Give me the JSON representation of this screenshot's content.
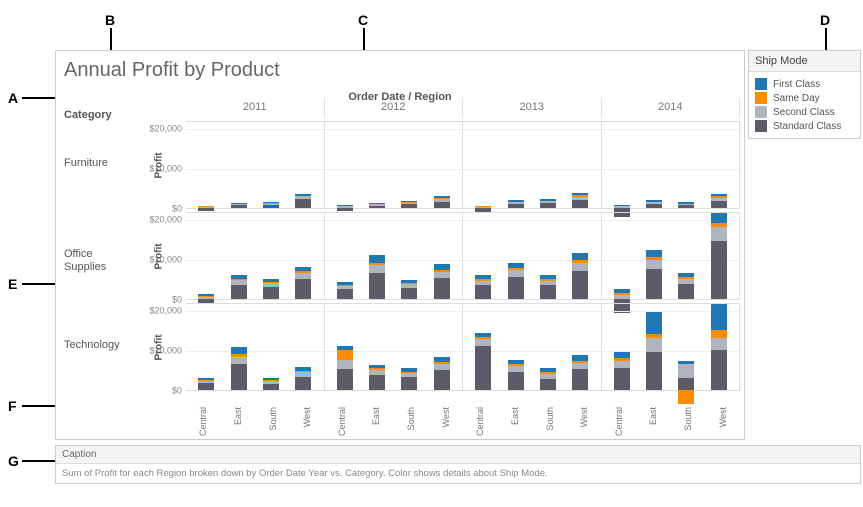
{
  "title": "Annual Profit by Product",
  "super_header": "Order Date / Region",
  "category_header": "Category",
  "legend": {
    "title": "Ship Mode"
  },
  "caption": {
    "label": "Caption",
    "text": "Sum of Profit for each Region broken down by Order Date Year vs. Category.  Color shows details about Ship Mode."
  },
  "callouts": {
    "A": "A",
    "B": "B",
    "C": "C",
    "D": "D",
    "E": "E",
    "F": "F",
    "G": "G"
  },
  "chart_data": {
    "type": "bar",
    "layout": "small-multiples",
    "row_facet": "Category",
    "col_facet": "Order Date (Year)",
    "x_field": "Region",
    "y_field": "Profit",
    "color_field": "Ship Mode",
    "categories_row": [
      "Furniture",
      "Office Supplies",
      "Technology"
    ],
    "categories_col": [
      "2011",
      "2012",
      "2013",
      "2014"
    ],
    "x_categories": [
      "Central",
      "East",
      "South",
      "West"
    ],
    "colors": {
      "First Class": "#1f77b4",
      "Same Day": "#ff8c00",
      "Second Class": "#b0b4bd",
      "Standard Class": "#5c5c66"
    },
    "y_axis": {
      "label": "Profit",
      "ticks": [
        0,
        10000,
        20000
      ],
      "tick_labels": [
        "$0",
        "$10,000",
        "$20,000"
      ],
      "range": [
        -5000,
        22000
      ]
    },
    "series_order": [
      "Standard Class",
      "Second Class",
      "Same Day",
      "First Class"
    ],
    "data": {
      "Furniture": {
        "2011": {
          "Central": {
            "Standard Class": -800,
            "Second Class": 300,
            "Same Day": 100,
            "First Class": 200
          },
          "East": {
            "Standard Class": 700,
            "Second Class": 300,
            "Same Day": 100,
            "First Class": 200
          },
          "South": {
            "Standard Class": 800,
            "Second Class": 300,
            "Same Day": 100,
            "First Class": 300
          },
          "West": {
            "Standard Class": 2300,
            "Second Class": 600,
            "Same Day": 200,
            "First Class": 400
          }
        },
        "2012": {
          "Central": {
            "Standard Class": -700,
            "Second Class": 400,
            "Same Day": 100,
            "First Class": 300
          },
          "East": {
            "Standard Class": 600,
            "Second Class": 300,
            "Same Day": 100,
            "First Class": 300
          },
          "South": {
            "Standard Class": 900,
            "Second Class": 400,
            "Same Day": 100,
            "First Class": 300
          },
          "West": {
            "Standard Class": 1600,
            "Second Class": 600,
            "Same Day": 200,
            "First Class": 500
          }
        },
        "2013": {
          "Central": {
            "Standard Class": -1000,
            "Second Class": 300,
            "Same Day": 100,
            "First Class": 200
          },
          "East": {
            "Standard Class": 1000,
            "Second Class": 400,
            "Same Day": 100,
            "First Class": 400
          },
          "South": {
            "Standard Class": 1200,
            "Second Class": 500,
            "Same Day": 100,
            "First Class": 400
          },
          "West": {
            "Standard Class": 2100,
            "Second Class": 700,
            "Same Day": 400,
            "First Class": 500
          }
        },
        "2014": {
          "Central": {
            "Standard Class": -2200,
            "Second Class": 400,
            "Same Day": 100,
            "First Class": 300
          },
          "East": {
            "Standard Class": 1000,
            "Second Class": 400,
            "Same Day": 200,
            "First Class": 400
          },
          "South": {
            "Standard Class": 700,
            "Second Class": 300,
            "Same Day": 100,
            "First Class": 300
          },
          "West": {
            "Standard Class": 1800,
            "Second Class": 700,
            "Same Day": 400,
            "First Class": 600
          }
        }
      },
      "Office Supplies": {
        "2011": {
          "Central": {
            "Standard Class": -1200,
            "Second Class": 500,
            "Same Day": 200,
            "First Class": 500
          },
          "East": {
            "Standard Class": 3500,
            "Second Class": 1200,
            "Same Day": 400,
            "First Class": 1000
          },
          "South": {
            "Standard Class": 3000,
            "Second Class": 1000,
            "Same Day": 300,
            "First Class": 800
          },
          "West": {
            "Standard Class": 5000,
            "Second Class": 1400,
            "Same Day": 500,
            "First Class": 1200
          }
        },
        "2012": {
          "Central": {
            "Standard Class": 2400,
            "Second Class": 800,
            "Same Day": 300,
            "First Class": 700
          },
          "East": {
            "Standard Class": 6500,
            "Second Class": 2000,
            "Same Day": 600,
            "First Class": 2000
          },
          "South": {
            "Standard Class": 2800,
            "Second Class": 900,
            "Same Day": 300,
            "First Class": 700
          },
          "West": {
            "Standard Class": 5200,
            "Second Class": 1600,
            "Same Day": 500,
            "First Class": 1400
          }
        },
        "2013": {
          "Central": {
            "Standard Class": 3500,
            "Second Class": 1000,
            "Same Day": 500,
            "First Class": 900
          },
          "East": {
            "Standard Class": 5500,
            "Second Class": 1700,
            "Same Day": 500,
            "First Class": 1400
          },
          "South": {
            "Standard Class": 3500,
            "Second Class": 1100,
            "Same Day": 400,
            "First Class": 1000
          },
          "West": {
            "Standard Class": 7000,
            "Second Class": 2100,
            "Same Day": 700,
            "First Class": 1800
          }
        },
        "2014": {
          "Central": {
            "Standard Class": -3500,
            "Second Class": 1000,
            "Same Day": 400,
            "First Class": 1000
          },
          "East": {
            "Standard Class": 7500,
            "Second Class": 2200,
            "Same Day": 700,
            "First Class": 1900
          },
          "South": {
            "Standard Class": 3800,
            "Second Class": 1200,
            "Same Day": 400,
            "First Class": 1000
          },
          "West": {
            "Standard Class": 14500,
            "Second Class": 3500,
            "Same Day": 1000,
            "First Class": 2500
          }
        }
      },
      "Technology": {
        "2011": {
          "Central": {
            "Standard Class": 1800,
            "Second Class": 500,
            "Same Day": 200,
            "First Class": 400
          },
          "East": {
            "Standard Class": 6500,
            "Second Class": 1800,
            "Same Day": 700,
            "First Class": 1800
          },
          "South": {
            "Standard Class": 1600,
            "Second Class": 600,
            "Same Day": 200,
            "First Class": 500
          },
          "West": {
            "Standard Class": 3200,
            "Second Class": 1200,
            "Same Day": 400,
            "First Class": 1000
          }
        },
        "2012": {
          "Central": {
            "Standard Class": 5200,
            "Second Class": 2200,
            "Same Day": 2500,
            "First Class": 1200
          },
          "East": {
            "Standard Class": 3800,
            "Second Class": 1200,
            "Same Day": 400,
            "First Class": 900
          },
          "South": {
            "Standard Class": 3200,
            "Second Class": 1000,
            "Same Day": 400,
            "First Class": 900
          },
          "West": {
            "Standard Class": 5000,
            "Second Class": 1500,
            "Same Day": 500,
            "First Class": 1300
          }
        },
        "2013": {
          "Central": {
            "Standard Class": 11000,
            "Second Class": 1800,
            "Same Day": 400,
            "First Class": 1000
          },
          "East": {
            "Standard Class": 4500,
            "Second Class": 1400,
            "Same Day": 500,
            "First Class": 1200
          },
          "South": {
            "Standard Class": 2800,
            "Second Class": 1200,
            "Same Day": 400,
            "First Class": 1100
          },
          "West": {
            "Standard Class": 5200,
            "Second Class": 1600,
            "Same Day": 500,
            "First Class": 1400
          }
        },
        "2014": {
          "Central": {
            "Standard Class": 5500,
            "Second Class": 1800,
            "Same Day": 600,
            "First Class": 1500
          },
          "East": {
            "Standard Class": 9500,
            "Second Class": 3500,
            "Same Day": 1000,
            "First Class": 5500
          },
          "South": {
            "Standard Class": 3000,
            "Second Class": 3500,
            "Same Day": -3500,
            "First Class": 800
          },
          "West": {
            "Standard Class": 10000,
            "Second Class": 3000,
            "Same Day": 2000,
            "First Class": 6500
          }
        }
      }
    }
  }
}
